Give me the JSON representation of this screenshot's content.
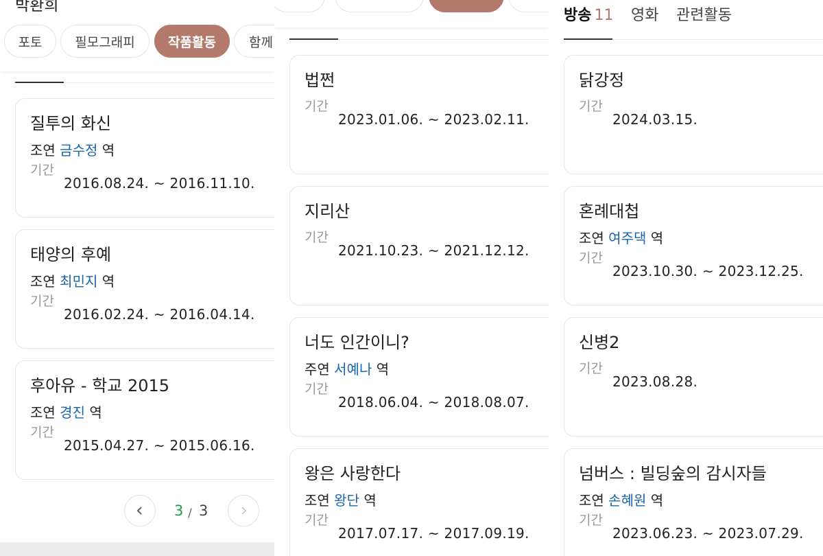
{
  "panel1": {
    "person_name": "박환희",
    "tabs": [
      {
        "label": "포토"
      },
      {
        "label": "필모그래피"
      },
      {
        "label": "작품활동"
      },
      {
        "label": "함께"
      }
    ],
    "cards": [
      {
        "title": "질투의 화신",
        "role_type": "조연",
        "character": "금수정",
        "role_suffix": "역",
        "period_label": "기간",
        "period": "2016.08.24. ~ 2016.11.10."
      },
      {
        "title": "태양의 후예",
        "role_type": "조연",
        "character": "최민지",
        "role_suffix": "역",
        "period_label": "기간",
        "period": "2016.02.24. ~ 2016.04.14."
      },
      {
        "title": "후아유 - 학교 2015",
        "role_type": "조연",
        "character": "경진",
        "role_suffix": "역",
        "period_label": "기간",
        "period": "2015.04.27. ~ 2015.06.16."
      }
    ],
    "pagination": {
      "current": "3",
      "separator": "/",
      "total": "3"
    }
  },
  "panel2": {
    "cards": [
      {
        "title": "법쩐",
        "period_label": "기간",
        "period": "2023.01.06. ~ 2023.02.11."
      },
      {
        "title": "지리산",
        "period_label": "기간",
        "period": "2021.10.23. ~ 2021.12.12."
      },
      {
        "title": "너도 인간이니?",
        "role_type": "주연",
        "character": "서예나",
        "role_suffix": "역",
        "period_label": "기간",
        "period": "2018.06.04. ~ 2018.08.07."
      },
      {
        "title": "왕은 사랑한다",
        "role_type": "조연",
        "character": "왕단",
        "role_suffix": "역",
        "period_label": "기간",
        "period": "2017.07.17. ~ 2017.09.19."
      }
    ]
  },
  "panel3": {
    "category_tabs": [
      {
        "label": "방송",
        "count": "11"
      },
      {
        "label": "영화"
      },
      {
        "label": "관련활동"
      }
    ],
    "cards": [
      {
        "title": "닭강정",
        "period_label": "기간",
        "period": "2024.03.15."
      },
      {
        "title": "혼례대첩",
        "role_type": "조연",
        "character": "여주댁",
        "role_suffix": "역",
        "period_label": "기간",
        "period": "2023.10.30. ~ 2023.12.25."
      },
      {
        "title": "신병2",
        "period_label": "기간",
        "period": "2023.08.28."
      },
      {
        "title": "넘버스 : 빌딩숲의 감시자들",
        "role_type": "조연",
        "character": "손혜원",
        "role_suffix": "역",
        "period_label": "기간",
        "period": "2023.06.23. ~ 2023.07.29."
      }
    ]
  },
  "colors": {
    "accent_pill": "#b3796b",
    "character_link": "#1a64b0",
    "page_current": "#1a9e4b",
    "muted_label": "#999999"
  },
  "icons": {
    "prev": "chevron-left-icon",
    "next": "chevron-right-icon"
  }
}
